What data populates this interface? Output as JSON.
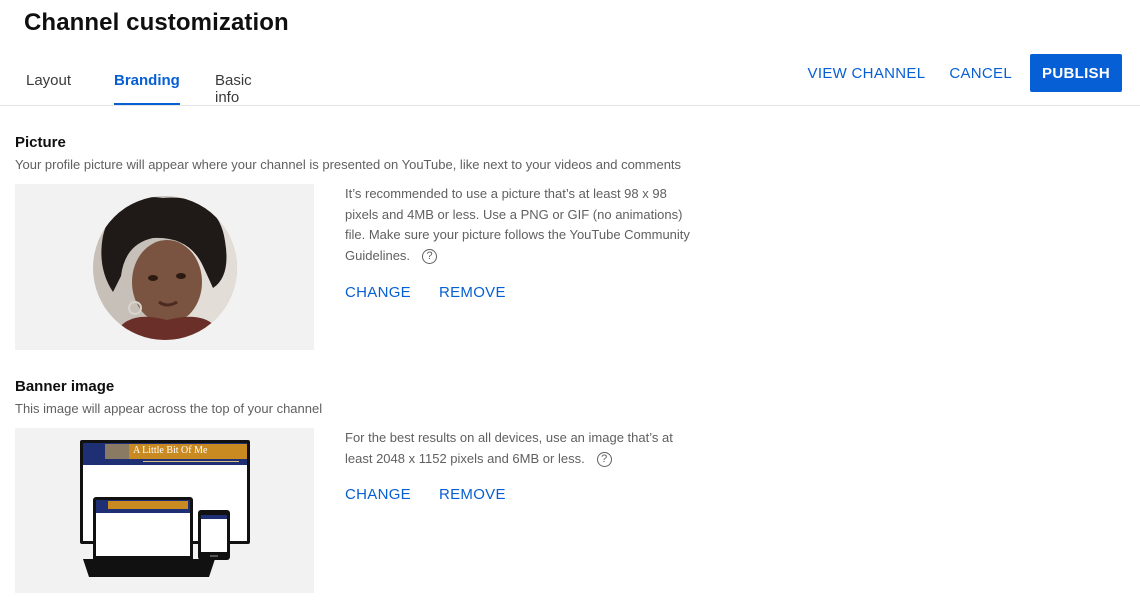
{
  "page": {
    "title": "Channel customization"
  },
  "tabs": [
    {
      "label": "Layout",
      "active": false
    },
    {
      "label": "Branding",
      "active": true
    },
    {
      "label": "Basic info",
      "active": false
    }
  ],
  "header_actions": {
    "view_channel": "VIEW CHANNEL",
    "cancel": "CANCEL",
    "publish": "PUBLISH"
  },
  "picture": {
    "title": "Picture",
    "description": "Your profile picture will appear where your channel is presented on YouTube, like next to your videos and comments",
    "info": "It’s recommended to use a picture that’s at least 98 x 98 pixels and 4MB or less. Use a PNG or GIF (no animations) file. Make sure your picture follows the YouTube Community Guidelines.",
    "change": "CHANGE",
    "remove": "REMOVE"
  },
  "banner": {
    "title": "Banner image",
    "description": "This image will appear across the top of your channel",
    "banner_text": "A Little Bit Of Me",
    "info": "For the best results on all devices, use an image that’s at least 2048 x 1152 pixels and 6MB or less.",
    "change": "CHANGE",
    "remove": "REMOVE"
  },
  "help_icon": "?",
  "colors": {
    "accent": "#065fd4",
    "preview_bg": "#f2f2f2",
    "banner_navy": "#1e2f73",
    "banner_gold": "#c98a22"
  }
}
